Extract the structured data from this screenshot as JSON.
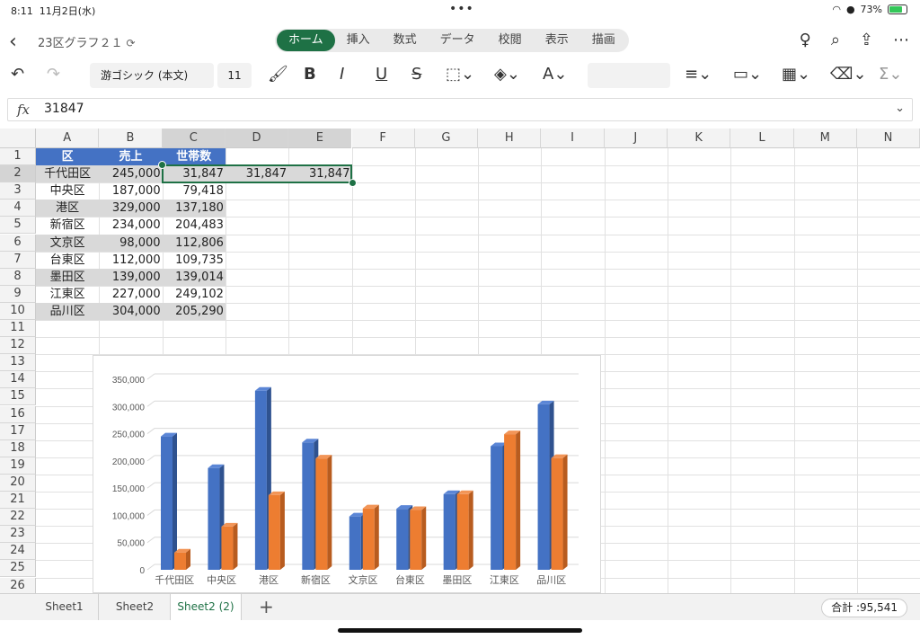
{
  "status": {
    "time": "8:11",
    "date": "11月2日(水)",
    "battery": "73%"
  },
  "app": {
    "filename": "23区グラフ２１"
  },
  "tabs": [
    "ホーム",
    "挿入",
    "数式",
    "データ",
    "校閲",
    "表示",
    "描画"
  ],
  "active_tab": 0,
  "ribbon": {
    "font": "游ゴシック (本文)",
    "size": "11"
  },
  "formula_bar": {
    "fx": "fx",
    "value": "31847"
  },
  "columns": [
    "A",
    "B",
    "C",
    "D",
    "E",
    "F",
    "G",
    "H",
    "I",
    "J",
    "K",
    "L",
    "M",
    "N"
  ],
  "rows": [
    "1",
    "2",
    "3",
    "4",
    "5",
    "6",
    "7",
    "8",
    "9",
    "10",
    "11",
    "12",
    "13",
    "14",
    "15",
    "16",
    "17",
    "18",
    "19",
    "20",
    "21",
    "22",
    "23",
    "24",
    "25",
    "26"
  ],
  "table": {
    "headers": [
      "区",
      "売上",
      "世帯数"
    ],
    "rows": [
      [
        "千代田区",
        "245,000",
        "31,847"
      ],
      [
        "中央区",
        "187,000",
        "79,418"
      ],
      [
        "港区",
        "329,000",
        "137,180"
      ],
      [
        "新宿区",
        "234,000",
        "204,483"
      ],
      [
        "文京区",
        "98,000",
        "112,806"
      ],
      [
        "台東区",
        "112,000",
        "109,735"
      ],
      [
        "墨田区",
        "139,000",
        "139,014"
      ],
      [
        "江東区",
        "227,000",
        "249,102"
      ],
      [
        "品川区",
        "304,000",
        "205,290"
      ]
    ],
    "extra_d2": "31,847",
    "extra_e2": "31,847"
  },
  "chart_data": {
    "type": "bar",
    "categories": [
      "千代田区",
      "中央区",
      "港区",
      "新宿区",
      "文京区",
      "台東区",
      "墨田区",
      "江東区",
      "品川区"
    ],
    "series": [
      {
        "values": [
          245000,
          187000,
          329000,
          234000,
          98000,
          112000,
          139000,
          227000,
          304000
        ],
        "color": "#4472c4"
      },
      {
        "values": [
          31847,
          79418,
          137180,
          204483,
          112806,
          109735,
          139014,
          249102,
          205290
        ],
        "color": "#ed7d31"
      }
    ],
    "ylim": [
      0,
      350000
    ],
    "yticks": [
      "0",
      "50,000",
      "100,000",
      "150,000",
      "200,000",
      "250,000",
      "300,000",
      "350,000"
    ],
    "grid": true,
    "legend": "none",
    "style": "3d-clustered-column"
  },
  "sheets": [
    "Sheet1",
    "Sheet2",
    "Sheet2 (2)"
  ],
  "active_sheet": 2,
  "summary": "合計 :95,541"
}
